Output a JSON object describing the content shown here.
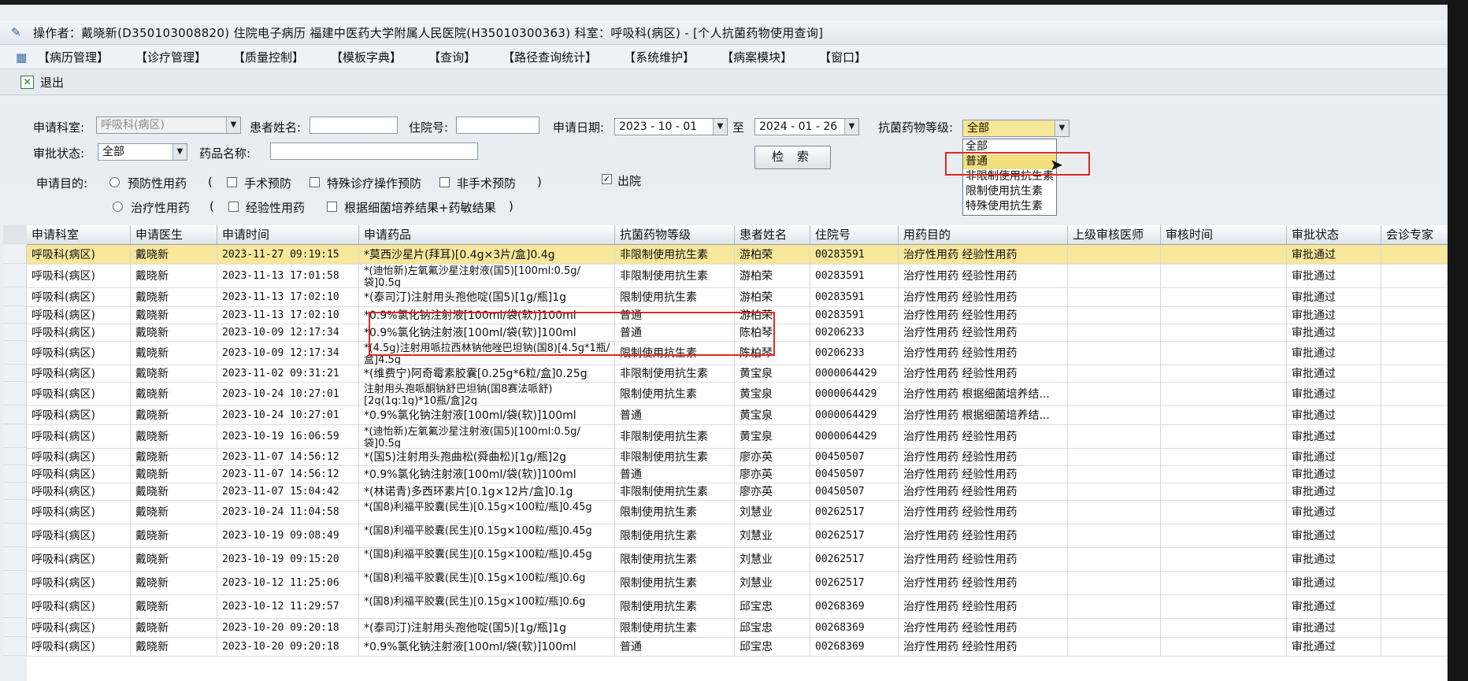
{
  "window": {
    "title": "操作者：戴晓新(D350103008820) 住院电子病历  福建中医药大学附属人民医院(H35010300363)  科室：呼吸科(病区) - [个人抗菌药物使用查询]"
  },
  "menu": [
    "【病历管理】",
    "【诊疗管理】",
    "【质量控制】",
    "【模板字典】",
    "【查询】",
    "【路径查询统计】",
    "【系统维护】",
    "【病案模块】",
    "【窗口】"
  ],
  "toolbar": {
    "exit_label": "退出"
  },
  "filters": {
    "dept_label": "申请科室:",
    "dept_value": "呼吸科(病区)",
    "patient_label": "患者姓名:",
    "patient_value": "",
    "admission_label": "住院号:",
    "admission_value": "",
    "date_label": "申请日期:",
    "date_from": "2023 - 10 - 01",
    "date_to_label": "至",
    "date_to": "2024 - 01 - 26",
    "grade_label": "抗菌药物等级:",
    "grade_value": "全部",
    "approval_label": "审批状态:",
    "approval_value": "全部",
    "drug_label": "药品名称:",
    "drug_value": "",
    "purpose_label": "申请目的:",
    "prophylactic_label": "预防性用药",
    "paren_open": "(",
    "paren_close": ")",
    "surgery_label": "手术预防",
    "special_label": "特殊诊疗操作预防",
    "nonsurgery_label": "非手术预防",
    "discharge_label": "出院",
    "therapeutic_label": "治疗性用药",
    "empirical_label": "经验性用药",
    "culture_label": "根据细菌培养结果+药敏结果",
    "search_label": "检 索"
  },
  "grade_options": [
    "全部",
    "普通",
    "非限制使用抗生素",
    "限制使用抗生素",
    "特殊使用抗生素"
  ],
  "grid": {
    "headers": [
      "申请科室",
      "申请医生",
      "申请时间",
      "申请药品",
      "抗菌药物等级",
      "患者姓名",
      "住院号",
      "用药目的",
      "上级审核医师",
      "审核时间",
      "审批状态",
      "会诊专家"
    ],
    "rows": [
      [
        "呼吸科(病区)",
        "戴晓新",
        "2023-11-27 09:19:15",
        "*莫西沙星片(拜耳)[0.4g×3片/盒]0.4g",
        "非限制使用抗生素",
        "游柏荣",
        "00283591",
        "治疗性用药  经验性用药",
        "",
        "",
        "审批通过",
        ""
      ],
      [
        "呼吸科(病区)",
        "戴晓新",
        "2023-11-13 17:01:58",
        "*(迪怡新)左氧氟沙星注射液(国5)[100ml:0.5g/袋]0.5g",
        "非限制使用抗生素",
        "游柏荣",
        "00283591",
        "治疗性用药  经验性用药",
        "",
        "",
        "审批通过",
        ""
      ],
      [
        "呼吸科(病区)",
        "戴晓新",
        "2023-11-13 17:02:10",
        "*(泰司汀)注射用头孢他啶(国5)[1g/瓶]1g",
        "限制使用抗生素",
        "游柏荣",
        "00283591",
        "治疗性用药  经验性用药",
        "",
        "",
        "审批通过",
        ""
      ],
      [
        "呼吸科(病区)",
        "戴晓新",
        "2023-11-13 17:02:10",
        "*0.9%氯化钠注射液[100ml/袋(软)]100ml",
        "普通",
        "游柏荣",
        "00283591",
        "治疗性用药  经验性用药",
        "",
        "",
        "审批通过",
        ""
      ],
      [
        "呼吸科(病区)",
        "戴晓新",
        "2023-10-09 12:17:34",
        "*0.9%氯化钠注射液[100ml/袋(软)]100ml",
        "普通",
        "陈柏琴",
        "00206233",
        "治疗性用药  经验性用药",
        "",
        "",
        "审批通过",
        ""
      ],
      [
        "呼吸科(病区)",
        "戴晓新",
        "2023-10-09 12:17:34",
        "*(4.5g)注射用哌拉西林钠他唑巴坦钠(国8)[4.5g*1瓶/盒]4.5g",
        "限制使用抗生素",
        "陈柏琴",
        "00206233",
        "治疗性用药  经验性用药",
        "",
        "",
        "审批通过",
        ""
      ],
      [
        "呼吸科(病区)",
        "戴晓新",
        "2023-11-02 09:31:21",
        "*(维费宁)阿奇霉素胶囊[0.25g*6粒/盒]0.25g",
        "非限制使用抗生素",
        "黄宝泉",
        "0000064429",
        "治疗性用药  经验性用药",
        "",
        "",
        "审批通过",
        ""
      ],
      [
        "呼吸科(病区)",
        "戴晓新",
        "2023-10-24 10:27:01",
        "注射用头孢哌酮钠舒巴坦钠(国8赛法哌舒)[2g(1g:1g)*10瓶/盒]2g",
        "限制使用抗生素",
        "黄宝泉",
        "0000064429",
        "治疗性用药  根据细菌培养结...",
        "",
        "",
        "审批通过",
        ""
      ],
      [
        "呼吸科(病区)",
        "戴晓新",
        "2023-10-24 10:27:01",
        "*0.9%氯化钠注射液[100ml/袋(软)]100ml",
        "普通",
        "黄宝泉",
        "0000064429",
        "治疗性用药  根据细菌培养结...",
        "",
        "",
        "审批通过",
        ""
      ],
      [
        "呼吸科(病区)",
        "戴晓新",
        "2023-10-19 16:06:59",
        "*(迪怡新)左氧氟沙星注射液(国5)[100ml:0.5g/袋]0.5g",
        "非限制使用抗生素",
        "黄宝泉",
        "0000064429",
        "治疗性用药  经验性用药",
        "",
        "",
        "审批通过",
        ""
      ],
      [
        "呼吸科(病区)",
        "戴晓新",
        "2023-11-07 14:56:12",
        "*(国5)注射用头孢曲松(舜曲松)[1g/瓶]2g",
        "非限制使用抗生素",
        "廖亦英",
        "00450507",
        "治疗性用药  经验性用药",
        "",
        "",
        "审批通过",
        ""
      ],
      [
        "呼吸科(病区)",
        "戴晓新",
        "2023-11-07 14:56:12",
        "*0.9%氯化钠注射液[100ml/袋(软)]100ml",
        "普通",
        "廖亦英",
        "00450507",
        "治疗性用药  经验性用药",
        "",
        "",
        "审批通过",
        ""
      ],
      [
        "呼吸科(病区)",
        "戴晓新",
        "2023-11-07 15:04:42",
        "*(林诺青)多西环素片[0.1g×12片/盒]0.1g",
        "非限制使用抗生素",
        "廖亦英",
        "00450507",
        "治疗性用药  经验性用药",
        "",
        "",
        "审批通过",
        ""
      ],
      [
        "呼吸科(病区)",
        "戴晓新",
        "2023-10-24 11:04:58",
        "*(国8)利福平胶囊(民生)[0.15g×100粒/瓶]0.45g",
        "限制使用抗生素",
        "刘慧业",
        "00262517",
        "治疗性用药  经验性用药",
        "",
        "",
        "审批通过",
        ""
      ],
      [
        "呼吸科(病区)",
        "戴晓新",
        "2023-10-19 09:08:49",
        "*(国8)利福平胶囊(民生)[0.15g×100粒/瓶]0.45g",
        "限制使用抗生素",
        "刘慧业",
        "00262517",
        "治疗性用药  经验性用药",
        "",
        "",
        "审批通过",
        ""
      ],
      [
        "呼吸科(病区)",
        "戴晓新",
        "2023-10-19 09:15:20",
        "*(国8)利福平胶囊(民生)[0.15g×100粒/瓶]0.45g",
        "限制使用抗生素",
        "刘慧业",
        "00262517",
        "治疗性用药  经验性用药",
        "",
        "",
        "审批通过",
        ""
      ],
      [
        "呼吸科(病区)",
        "戴晓新",
        "2023-10-12 11:25:06",
        "*(国8)利福平胶囊(民生)[0.15g×100粒/瓶]0.6g",
        "限制使用抗生素",
        "刘慧业",
        "00262517",
        "治疗性用药  经验性用药",
        "",
        "",
        "审批通过",
        ""
      ],
      [
        "呼吸科(病区)",
        "戴晓新",
        "2023-10-12 11:29:57",
        "*(国8)利福平胶囊(民生)[0.15g×100粒/瓶]0.6g",
        "限制使用抗生素",
        "邱宝忠",
        "00268369",
        "治疗性用药  经验性用药",
        "",
        "",
        "审批通过",
        ""
      ],
      [
        "呼吸科(病区)",
        "戴晓新",
        "2023-10-20 09:20:18",
        "*(泰司汀)注射用头孢他啶(国5)[1g/瓶]1g",
        "限制使用抗生素",
        "邱宝忠",
        "00268369",
        "治疗性用药  经验性用药",
        "",
        "",
        "审批通过",
        ""
      ],
      [
        "呼吸科(病区)",
        "戴晓新",
        "2023-10-20 09:20:18",
        "*0.9%氯化钠注射液[100ml/袋(软)]100ml",
        "普通",
        "邱宝忠",
        "00268369",
        "治疗性用药  经验性用药",
        "",
        "",
        "审批通过",
        ""
      ]
    ]
  }
}
